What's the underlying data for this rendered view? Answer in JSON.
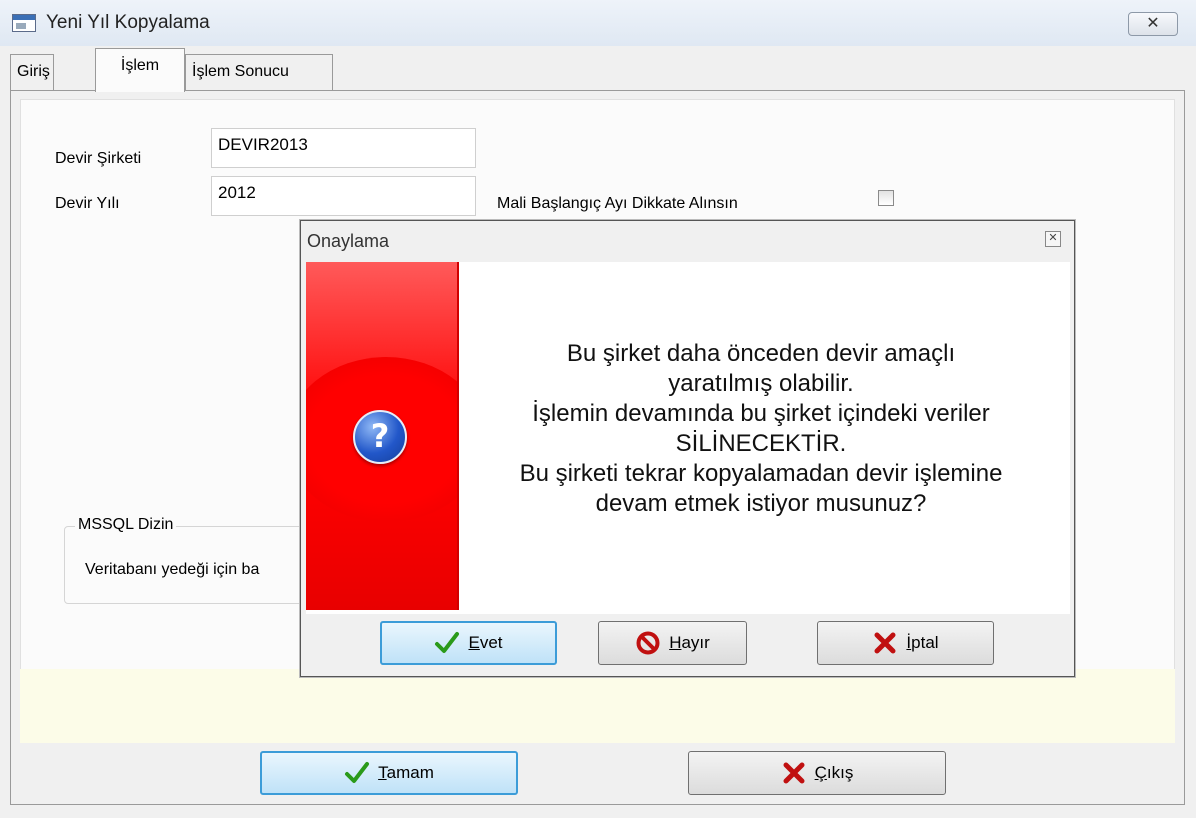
{
  "window": {
    "title": "Yeni Yıl Kopyalama",
    "close_glyph": "✕"
  },
  "tabs": [
    {
      "label": "Giriş",
      "active": false
    },
    {
      "label": "İşlem",
      "active": true
    },
    {
      "label": "İşlem Sonucu",
      "active": false
    }
  ],
  "form": {
    "devir_sirketi_label": "Devir Şirketi",
    "devir_sirketi_value": "DEVIR2013",
    "devir_yili_label": "Devir Yılı",
    "devir_yili_value": "2012",
    "mali_label": "Mali Başlangıç Ayı Dikkate Alınsın",
    "mali_checked": false,
    "mssql_legend": "MSSQL Dizin",
    "mssql_text": "Veritabanı yedeği için ba"
  },
  "buttons": {
    "ok_label_first": "T",
    "ok_label_rest": "amam",
    "exit_label_first": "Ç",
    "exit_label_rest": "ıkış"
  },
  "dialog": {
    "title": "Onaylama",
    "close_glyph": "✕",
    "icon_glyph": "?",
    "message_lines": [
      "Bu şirket daha önceden devir amaçlı",
      "yaratılmış olabilir.",
      "İşlemin devamında bu şirket içindeki veriler",
      "SİLİNECEKTİR.",
      "Bu şirketi tekrar kopyalamadan devir işlemine",
      "devam etmek istiyor musunuz?"
    ],
    "yes_first": "E",
    "yes_rest": "vet",
    "no_first": "H",
    "no_rest": "ayır",
    "cancel_first": "İ",
    "cancel_rest": "ptal"
  },
  "colors": {
    "check_green": "#2a9a1a",
    "cross_red": "#c01010",
    "dialog_strip": "#ff0000",
    "info_strip": "#fcfce8"
  },
  "icons": [
    "app-icon",
    "close-icon",
    "question-icon",
    "check-icon",
    "no-entry-icon",
    "cross-icon"
  ]
}
